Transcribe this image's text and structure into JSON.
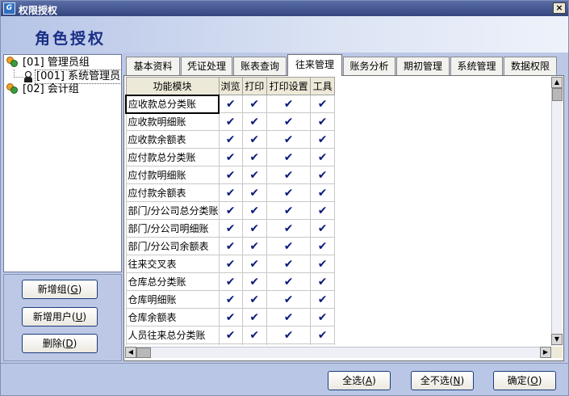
{
  "window": {
    "title": "权限授权",
    "close_glyph": "×",
    "app_icon_text": "G"
  },
  "header": {
    "title": "角色授权"
  },
  "tree": {
    "nodes": [
      {
        "label": "[01] 管理员组",
        "type": "group"
      },
      {
        "label": "[001] 系统管理员",
        "type": "user"
      },
      {
        "label": "[02] 会计组",
        "type": "group"
      }
    ]
  },
  "left_buttons": {
    "add_group": {
      "label": "新增组(",
      "key": "G",
      "suffix": ")"
    },
    "add_user": {
      "label": "新增用户(",
      "key": "U",
      "suffix": ")"
    },
    "delete": {
      "label": "删除(",
      "key": "D",
      "suffix": ")"
    }
  },
  "tabs": [
    {
      "label": "基本资料",
      "active": false
    },
    {
      "label": "凭证处理",
      "active": false
    },
    {
      "label": "账表查询",
      "active": false
    },
    {
      "label": "往来管理",
      "active": true
    },
    {
      "label": "账务分析",
      "active": false
    },
    {
      "label": "期初管理",
      "active": false
    },
    {
      "label": "系统管理",
      "active": false
    },
    {
      "label": "数据权限",
      "active": false
    }
  ],
  "grid": {
    "columns": [
      "功能模块",
      "浏览",
      "打印",
      "打印设置",
      "工具"
    ],
    "check_glyph": "✔",
    "rows": [
      {
        "module": "应收款总分类账",
        "browse": true,
        "print": true,
        "print_setup": true,
        "tools": true
      },
      {
        "module": "应收款明细账",
        "browse": true,
        "print": true,
        "print_setup": true,
        "tools": true
      },
      {
        "module": "应收款余额表",
        "browse": true,
        "print": true,
        "print_setup": true,
        "tools": true
      },
      {
        "module": "应付款总分类账",
        "browse": true,
        "print": true,
        "print_setup": true,
        "tools": true
      },
      {
        "module": "应付款明细账",
        "browse": true,
        "print": true,
        "print_setup": true,
        "tools": true
      },
      {
        "module": "应付款余额表",
        "browse": true,
        "print": true,
        "print_setup": true,
        "tools": true
      },
      {
        "module": "部门/分公司总分类账",
        "browse": true,
        "print": true,
        "print_setup": true,
        "tools": true
      },
      {
        "module": "部门/分公司明细账",
        "browse": true,
        "print": true,
        "print_setup": true,
        "tools": true
      },
      {
        "module": "部门/分公司余额表",
        "browse": true,
        "print": true,
        "print_setup": true,
        "tools": true
      },
      {
        "module": "往来交叉表",
        "browse": true,
        "print": true,
        "print_setup": true,
        "tools": true
      },
      {
        "module": "仓库总分类账",
        "browse": true,
        "print": true,
        "print_setup": true,
        "tools": true
      },
      {
        "module": "仓库明细账",
        "browse": true,
        "print": true,
        "print_setup": true,
        "tools": true
      },
      {
        "module": "仓库余额表",
        "browse": true,
        "print": true,
        "print_setup": true,
        "tools": true
      },
      {
        "module": "人员往来总分类账",
        "browse": true,
        "print": true,
        "print_setup": true,
        "tools": true
      },
      {
        "module": "",
        "browse": true,
        "print": true,
        "print_setup": true,
        "tools": true
      }
    ]
  },
  "scrollbars": {
    "up": "▲",
    "down": "▼",
    "left": "◀",
    "right": "▶"
  },
  "bottom_buttons": {
    "select_all": {
      "label": "全选(",
      "key": "A",
      "suffix": ")"
    },
    "select_none": {
      "label": "全不选(",
      "key": "N",
      "suffix": ")"
    },
    "ok": {
      "label": "确定(",
      "key": "O",
      "suffix": ")"
    }
  },
  "colors": {
    "accent": "#1a2f86",
    "titlebar": "#34457c",
    "check": "#0c1a7a"
  }
}
